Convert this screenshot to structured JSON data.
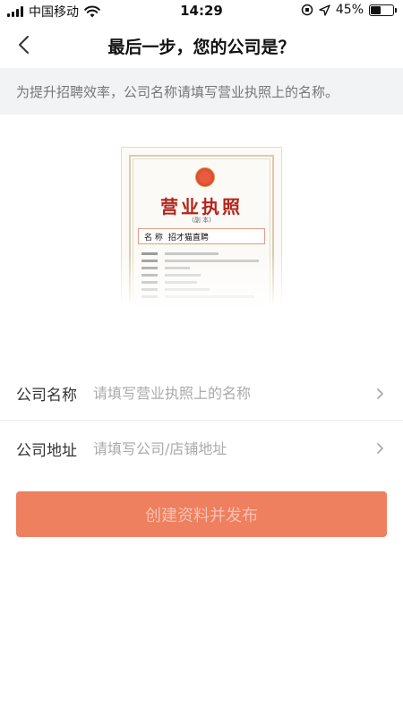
{
  "status_bar": {
    "carrier": "中国移动",
    "time": "14:29",
    "battery": "45%",
    "battery_level": 0.45,
    "icons": [
      "signal-icon",
      "wifi-icon",
      "orientation-lock-icon",
      "location-icon",
      "battery-icon"
    ]
  },
  "nav": {
    "title": "最后一步，您的公司是？",
    "back_icon": "chevron-left-icon"
  },
  "hint": "为提升招聘效率，公司名称请填写营业执照上的名称。",
  "license": {
    "title": "营业执照",
    "subtitle": "(副 本)",
    "name_label": "名 称",
    "name_value": "招才猫直聘"
  },
  "form": {
    "company_name": {
      "label": "公司名称",
      "placeholder": "请填写营业执照上的名称",
      "value": ""
    },
    "company_address": {
      "label": "公司地址",
      "placeholder": "请填写公司/店铺地址",
      "value": ""
    }
  },
  "submit_label": "创建资料并发布",
  "colors": {
    "accent": "#ee7f5f",
    "hint_bg": "#f2f3f5",
    "license_red": "#b3251c"
  }
}
